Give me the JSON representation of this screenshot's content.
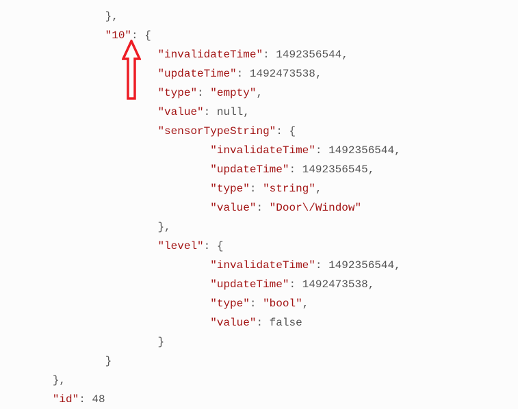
{
  "lines": {
    "l0_indent": "                },",
    "l1_indent": "                ",
    "l1_key": "\"10\"",
    "l1_rest": ": {",
    "l2_indent": "                        ",
    "l2_key": "\"invalidateTime\"",
    "l2_sep": ": ",
    "l2_val": "1492356544",
    "l2_end": ",",
    "l3_indent": "                        ",
    "l3_key": "\"updateTime\"",
    "l3_sep": ": ",
    "l3_val": "1492473538",
    "l3_end": ",",
    "l4_indent": "                        ",
    "l4_key": "\"type\"",
    "l4_sep": ": ",
    "l4_val": "\"empty\"",
    "l4_end": ",",
    "l5_indent": "                        ",
    "l5_key": "\"value\"",
    "l5_sep": ": ",
    "l5_val": "null",
    "l5_end": ",",
    "l6_indent": "                        ",
    "l6_key": "\"sensorTypeString\"",
    "l6_rest": ": {",
    "l7_indent": "                                ",
    "l7_key": "\"invalidateTime\"",
    "l7_sep": ": ",
    "l7_val": "1492356544",
    "l7_end": ",",
    "l8_indent": "                                ",
    "l8_key": "\"updateTime\"",
    "l8_sep": ": ",
    "l8_val": "1492356545",
    "l8_end": ",",
    "l9_indent": "                                ",
    "l9_key": "\"type\"",
    "l9_sep": ": ",
    "l9_val": "\"string\"",
    "l9_end": ",",
    "l10_indent": "                                ",
    "l10_key": "\"value\"",
    "l10_sep": ": ",
    "l10_val": "\"Door\\/Window\"",
    "l11_indent": "                        },",
    "l12_indent": "                        ",
    "l12_key": "\"level\"",
    "l12_rest": ": {",
    "l13_indent": "                                ",
    "l13_key": "\"invalidateTime\"",
    "l13_sep": ": ",
    "l13_val": "1492356544",
    "l13_end": ",",
    "l14_indent": "                                ",
    "l14_key": "\"updateTime\"",
    "l14_sep": ": ",
    "l14_val": "1492473538",
    "l14_end": ",",
    "l15_indent": "                                ",
    "l15_key": "\"type\"",
    "l15_sep": ": ",
    "l15_val": "\"bool\"",
    "l15_end": ",",
    "l16_indent": "                                ",
    "l16_key": "\"value\"",
    "l16_sep": ": ",
    "l16_val": "false",
    "l17_indent": "                        }",
    "l18_indent": "                }",
    "l19_indent": "        },",
    "l20_indent": "        ",
    "l20_key": "\"id\"",
    "l20_sep": ": ",
    "l20_val": "48"
  },
  "annotation": {
    "color": "#ed1c24"
  }
}
